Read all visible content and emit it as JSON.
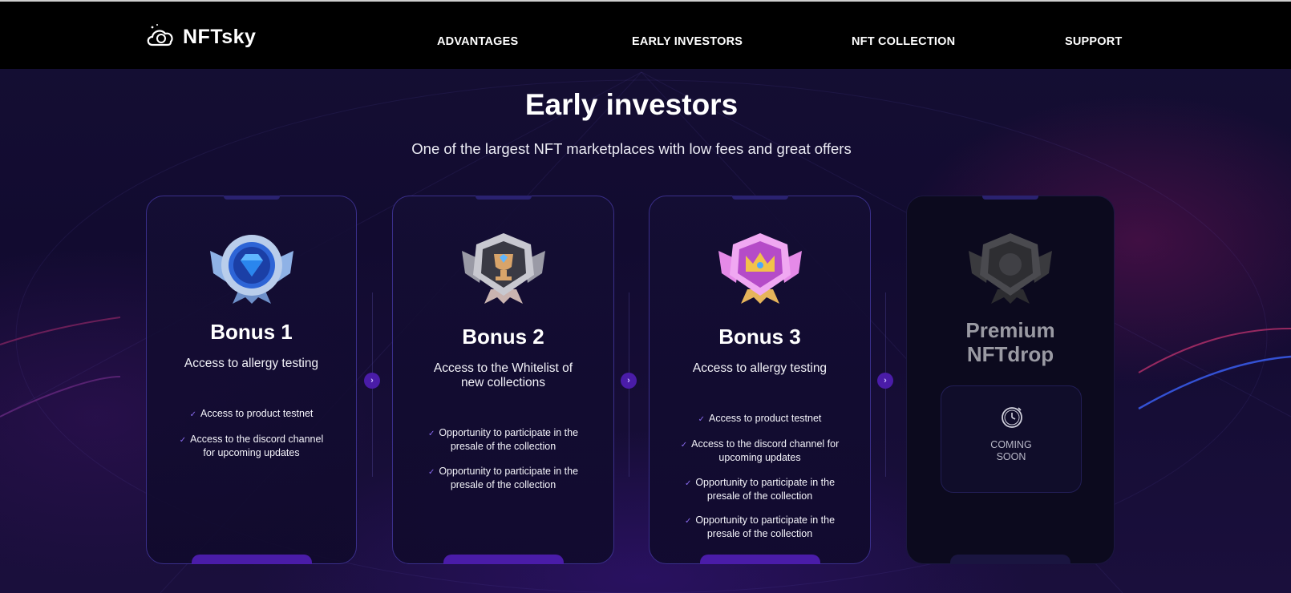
{
  "brand": {
    "name": "NFTsky"
  },
  "nav": [
    "ADVANTAGES",
    "EARLY INVESTORS",
    "NFT COLLECTION",
    "SUPPORT"
  ],
  "section": {
    "title": "Early investors",
    "subtitle": "One of the largest NFT marketplaces with low fees and great offers"
  },
  "cards": [
    {
      "title": "Bonus 1",
      "description": "Access to allergy testing",
      "features": [
        "Access to product testnet",
        "Access to the discord channel",
        "for upcoming updates"
      ],
      "badge_icon": "diamond-badge-icon"
    },
    {
      "title": "Bonus 2",
      "description_lines": [
        "Access to the Whitelist of",
        "new collections"
      ],
      "features": [
        "Opportunity to participate in the",
        "presale of the collection",
        "Opportunity to participate in the",
        "presale of the collection"
      ],
      "badge_icon": "trophy-badge-icon"
    },
    {
      "title": "Bonus 3",
      "description": "Access to allergy testing",
      "features": [
        "Access to product testnet",
        "Access to the discord channel for",
        "upcoming updates",
        "Opportunity to participate in the",
        "presale of the collection",
        "Opportunity to participate in the",
        "presale of the collection"
      ],
      "badge_icon": "crown-badge-icon"
    },
    {
      "title_lines": [
        "Premium",
        "NFTdrop"
      ],
      "status_lines": [
        "COMING",
        "SOON"
      ],
      "badge_icon": "locked-badge-icon",
      "status_icon": "timer-icon"
    }
  ],
  "colors": {
    "accent": "#4a1ca8",
    "background": "#120b30",
    "card_border": "#3a2f8a"
  }
}
